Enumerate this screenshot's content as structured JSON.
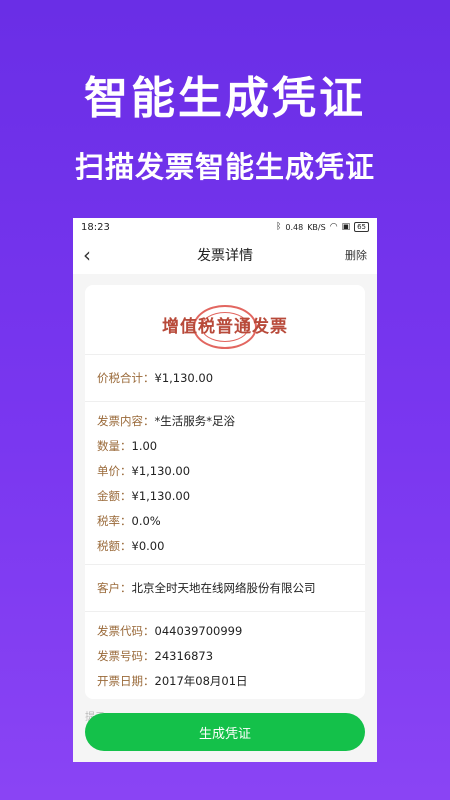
{
  "promo": {
    "headline": "智能生成凭证",
    "subline": "扫描发票智能生成凭证"
  },
  "status_bar": {
    "time": "18:23",
    "net_speed": "0.48",
    "net_unit": "KB/S",
    "battery": "65"
  },
  "nav": {
    "back_icon": "‹",
    "title": "发票详情",
    "delete_label": "删除"
  },
  "invoice": {
    "type": "增值税普通发票",
    "total": {
      "label": "价税合计：",
      "value": "¥1,130.00"
    },
    "items": [
      {
        "label": "发票内容：",
        "value": "*生活服务*足浴"
      },
      {
        "label": "数量：",
        "value": "1.00"
      },
      {
        "label": "单价：",
        "value": "¥1,130.00"
      },
      {
        "label": "金额：",
        "value": "¥1,130.00"
      },
      {
        "label": "税率：",
        "value": "0.0%"
      },
      {
        "label": "税额：",
        "value": "¥0.00"
      }
    ],
    "buyer": {
      "label": "客户：",
      "value": "北京全时天地在线网络股份有限公司"
    },
    "codes": [
      {
        "label": "发票代码：",
        "value": "044039700999"
      },
      {
        "label": "发票号码：",
        "value": "24316873"
      },
      {
        "label": "开票日期：",
        "value": "2017年08月01日"
      }
    ]
  },
  "tip_text": "提示",
  "generate_button": "生成凭证"
}
